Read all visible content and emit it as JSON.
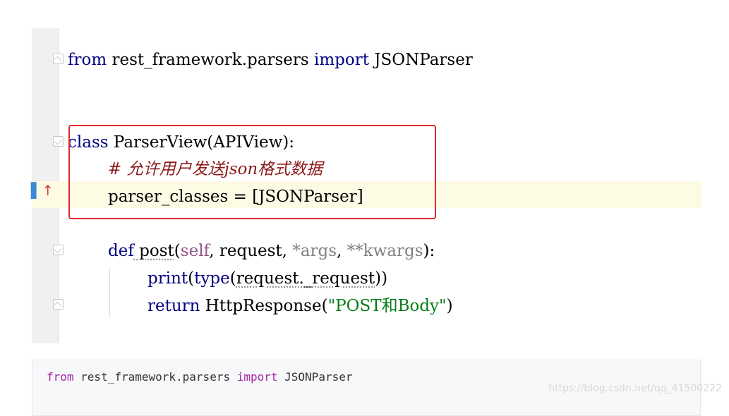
{
  "code": {
    "line1": {
      "kw": "from",
      "module": " rest_framework.parsers ",
      "kw2": "import",
      "name": " JSONParser"
    },
    "line2": {
      "kw": "class",
      "rest": " ParserView(APIView):"
    },
    "line3": {
      "comment": "# 允许用户发送json格式数据"
    },
    "line4": {
      "text": "parser_classes = [JSONParser]"
    },
    "line5": {
      "kw": "def",
      "name": " post",
      "open": "(",
      "self": "self",
      "sep1": ", request, ",
      "args": "*args",
      "sep2": ", ",
      "kwargs": "**kwargs",
      "close": "):"
    },
    "line6": {
      "builtin": "print",
      "p1": "(",
      "builtin2": "type",
      "p2": "(",
      "arg": "request._request",
      "p3": "))"
    },
    "line7": {
      "kw": "return",
      "call": " HttpResponse(",
      "str": "\"POST和Body\"",
      "end": ")"
    }
  },
  "snippet": {
    "kw": "from",
    "module": " rest_framework.parsers ",
    "kw2": "import",
    "name": " JSONParser"
  },
  "watermark": "https://blog.csdn.net/qq_41500222",
  "colors": {
    "keyword": "#000080",
    "self": "#94558d",
    "string": "#067d17",
    "comment": "#8c1a1a",
    "highlight": "#fefbe5",
    "box": "#e0282d"
  }
}
